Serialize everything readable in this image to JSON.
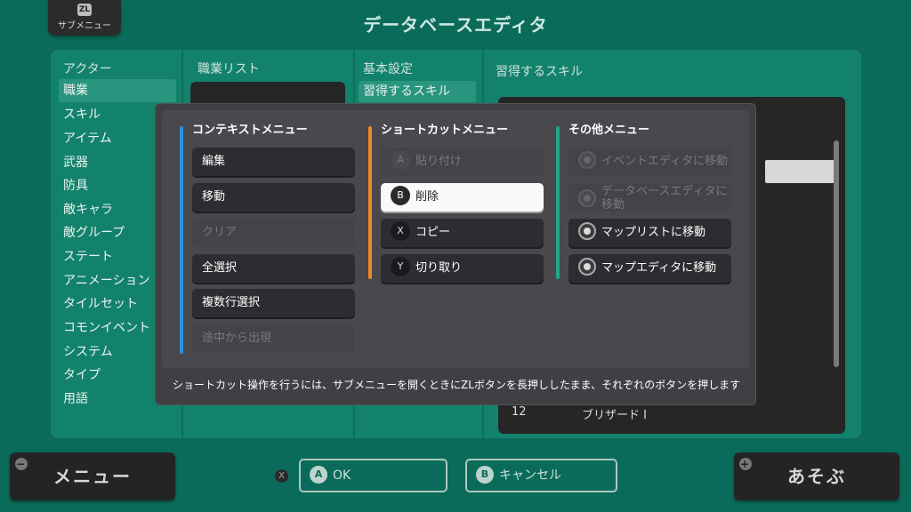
{
  "header": {
    "submenu_key": "ZL",
    "submenu_label": "サブメニュー",
    "title": "データベースエディタ"
  },
  "sidebar": {
    "heading": "アクター",
    "items": [
      {
        "label": "職業",
        "selected": true
      },
      {
        "label": "スキル"
      },
      {
        "label": "アイテム"
      },
      {
        "label": "武器"
      },
      {
        "label": "防具"
      },
      {
        "label": "敵キャラ"
      },
      {
        "label": "敵グループ"
      },
      {
        "label": "ステート"
      },
      {
        "label": "アニメーション"
      },
      {
        "label": "タイルセット"
      },
      {
        "label": "コモンイベント"
      },
      {
        "label": "システム"
      },
      {
        "label": "タイプ"
      },
      {
        "label": "用語"
      }
    ]
  },
  "job_list": {
    "heading": "職業リスト"
  },
  "basic": {
    "heading": "基本設定",
    "selected_item": "習得するスキル"
  },
  "skills": {
    "heading": "習得するスキル",
    "rows": [
      {
        "num": "12",
        "name": "ブリザード I"
      }
    ]
  },
  "modal": {
    "context": {
      "title": "コンテキストメニュー",
      "color": "#2f8fe0",
      "items": [
        {
          "label": "編集",
          "enabled": true
        },
        {
          "label": "移動",
          "enabled": true
        },
        {
          "label": "クリア",
          "enabled": false
        },
        {
          "label": "全選択",
          "enabled": true
        },
        {
          "label": "複数行選択",
          "enabled": true
        },
        {
          "label": "途中から出現",
          "enabled": false
        }
      ]
    },
    "shortcut": {
      "title": "ショートカットメニュー",
      "color": "#f08a1c",
      "items": [
        {
          "key": "A",
          "label": "貼り付け",
          "enabled": false
        },
        {
          "key": "B",
          "label": "削除",
          "enabled": true,
          "highlighted": true
        },
        {
          "key": "X",
          "label": "コピー",
          "enabled": true
        },
        {
          "key": "Y",
          "label": "切り取り",
          "enabled": true
        }
      ]
    },
    "other": {
      "title": "その他メニュー",
      "color": "#1fa58a",
      "items": [
        {
          "icon": "event-editor-icon",
          "label": "イベントエディタに移動",
          "enabled": false
        },
        {
          "icon": "database-editor-icon",
          "label_line1": "データベースエディタに",
          "label_line2": "移動",
          "enabled": false
        },
        {
          "icon": "map-list-icon",
          "label": "マップリストに移動",
          "enabled": true
        },
        {
          "icon": "map-editor-icon",
          "label": "マップエディタに移動",
          "enabled": true
        }
      ]
    },
    "hint": "ショートカット操作を行うには、サブメニューを開くときにZLボタンを長押ししたまま、それぞれのボタンを押します"
  },
  "footer": {
    "menu_icon": "−",
    "menu_label": "メニュー",
    "x_key": "X",
    "ok_key": "A",
    "ok_label": "OK",
    "cancel_key": "B",
    "cancel_label": "キャンセル",
    "play_icon": "+",
    "play_label": "あそぶ"
  }
}
